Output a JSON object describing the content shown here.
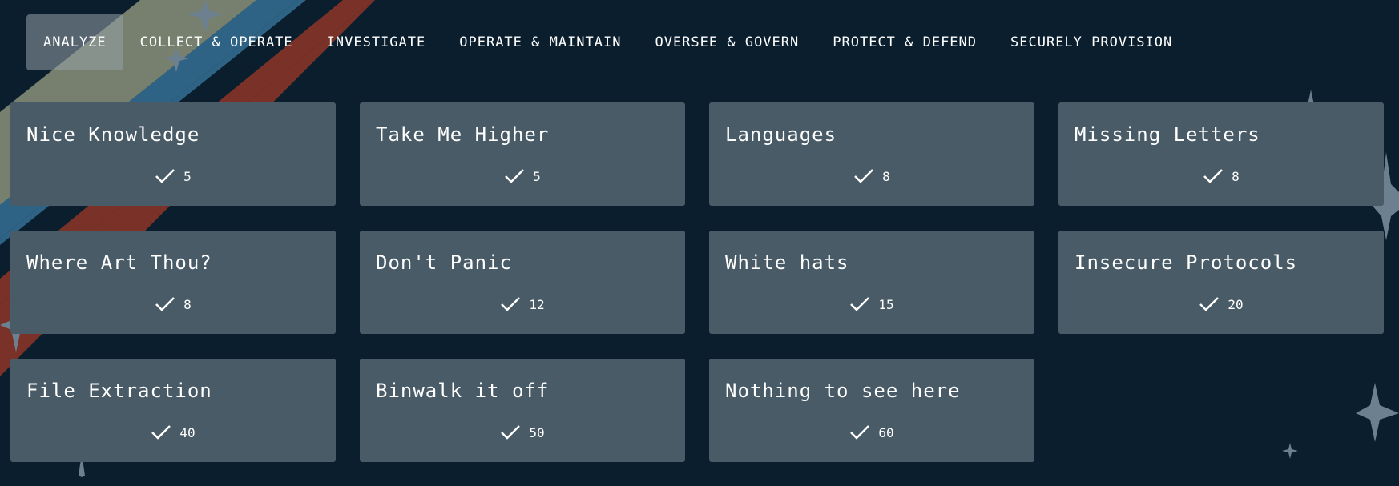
{
  "colors": {
    "background": "#0a1e2e",
    "card": "#485b66",
    "stripe_gray": "#77806f",
    "stripe_blue": "#2e6385",
    "stripe_red": "#7a3228",
    "star": "#6d8090"
  },
  "tabs": [
    {
      "label": "ANALYZE",
      "active": true
    },
    {
      "label": "COLLECT & OPERATE",
      "active": false
    },
    {
      "label": "INVESTIGATE",
      "active": false
    },
    {
      "label": "OPERATE & MAINTAIN",
      "active": false
    },
    {
      "label": "OVERSEE & GOVERN",
      "active": false
    },
    {
      "label": "PROTECT & DEFEND",
      "active": false
    },
    {
      "label": "SECURELY PROVISION",
      "active": false
    }
  ],
  "challenges": [
    {
      "title": "Nice Knowledge",
      "solves": "5",
      "icon": "check-icon"
    },
    {
      "title": "Take Me Higher",
      "solves": "5",
      "icon": "check-icon"
    },
    {
      "title": "Languages",
      "solves": "8",
      "icon": "check-icon"
    },
    {
      "title": "Missing Letters",
      "solves": "8",
      "icon": "check-icon"
    },
    {
      "title": "Where Art Thou?",
      "solves": "8",
      "icon": "check-icon"
    },
    {
      "title": "Don't Panic",
      "solves": "12",
      "icon": "check-icon"
    },
    {
      "title": "White hats",
      "solves": "15",
      "icon": "check-icon"
    },
    {
      "title": "Insecure Protocols",
      "solves": "20",
      "icon": "check-icon"
    },
    {
      "title": "File Extraction",
      "solves": "40",
      "icon": "check-icon"
    },
    {
      "title": "Binwalk it off",
      "solves": "50",
      "icon": "check-icon"
    },
    {
      "title": "Nothing to see here",
      "solves": "60",
      "icon": "check-icon"
    }
  ]
}
